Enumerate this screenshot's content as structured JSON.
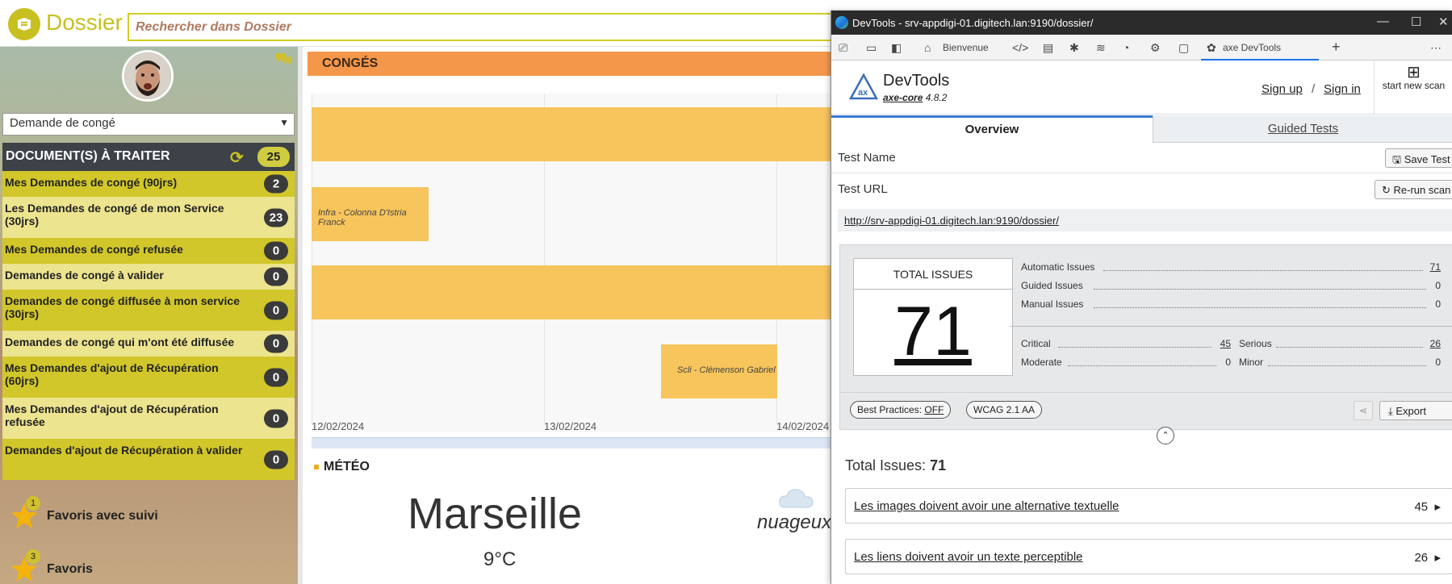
{
  "app": {
    "title": "Dossier",
    "search_placeholder": "Rechercher dans Dossier",
    "brand_color": "#c8c020"
  },
  "sidebar": {
    "select_value": "Demande de congé",
    "header_label": "DOCUMENT(S) À TRAITER",
    "header_count": "25",
    "items": [
      {
        "label": "Mes Demandes de congé (90jrs)",
        "count": "2"
      },
      {
        "label": "Les Demandes de congé de mon Service (30jrs)",
        "count": "23"
      },
      {
        "label": "Mes Demandes de congé refusée",
        "count": "0"
      },
      {
        "label": "Demandes de congé à valider",
        "count": "0"
      },
      {
        "label": "Demandes de congé diffusée à mon service (30jrs)",
        "count": "0"
      },
      {
        "label": "Demandes de congé qui m'ont été diffusée",
        "count": "0"
      },
      {
        "label": "Mes Demandes d'ajout de Récupération (60jrs)",
        "count": "0"
      },
      {
        "label": "Mes Demandes d'ajout de Récupération refusée",
        "count": "0"
      },
      {
        "label": "Demandes d'ajout de Récupération à valider",
        "count": "0"
      }
    ],
    "favorites": [
      {
        "label": "Favoris avec suivi",
        "count": "1"
      },
      {
        "label": "Favoris",
        "count": "3"
      }
    ]
  },
  "content": {
    "conges_title": "CONGÉS",
    "gantt": {
      "bars": [
        {
          "label": ""
        },
        {
          "label": "Infra - Colonna D'Istria Franck"
        },
        {
          "label": ""
        },
        {
          "label": "Scli - Clémenson Gabriel"
        }
      ],
      "dates": [
        "12/02/2024",
        "13/02/2024",
        "14/02/2024"
      ]
    },
    "meteo_title": "MÉTÉO",
    "city": "Marseille",
    "temperature": "9°C",
    "weather": "nuageux"
  },
  "devtools": {
    "window_title": "DevTools - srv-appdigi-01.digitech.lan:9190/dossier/",
    "toolbar": {
      "welcome_tab": "Bienvenue",
      "axe_tab": "axe DevTools"
    },
    "axe": {
      "name": "DevTools",
      "core_label": "axe-core",
      "core_version": "4.8.2",
      "sign_up": "Sign up",
      "sign_in": "Sign in",
      "new_scan": "start new scan",
      "tab_overview": "Overview",
      "tab_guided": "Guided Tests",
      "test_name_label": "Test Name",
      "save_test": "Save Test",
      "test_url_label": "Test URL",
      "rerun_scan": "Re-run scan",
      "url": "http://srv-appdigi-01.digitech.lan:9190/dossier/",
      "total_issues_label": "TOTAL ISSUES",
      "total_issues": "71",
      "automatic_label": "Automatic Issues",
      "automatic": "71",
      "guided_label": "Guided Issues",
      "guided": "0",
      "manual_label": "Manual Issues",
      "manual": "0",
      "critical_label": "Critical",
      "critical": "45",
      "serious_label": "Serious",
      "serious": "26",
      "moderate_label": "Moderate",
      "moderate": "0",
      "minor_label": "Minor",
      "minor": "0",
      "best_practices_label": "Best Practices:",
      "best_practices_value": "OFF",
      "wcag": "WCAG 2.1 AA",
      "export": "Export",
      "total_line_label": "Total Issues:",
      "total_line_value": "71",
      "issues": [
        {
          "title": "Les images doivent avoir une alternative textuelle",
          "count": "45"
        },
        {
          "title": "Les liens doivent avoir un texte perceptible",
          "count": "26"
        }
      ]
    }
  }
}
